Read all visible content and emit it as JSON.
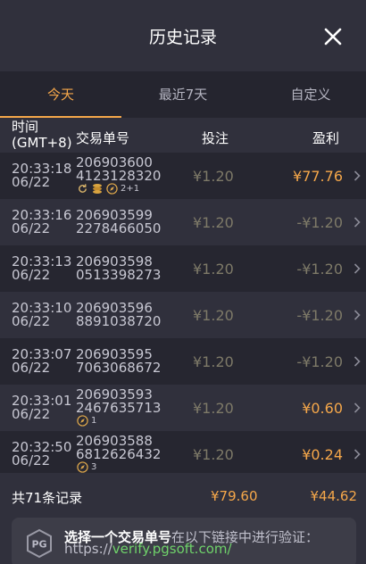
{
  "header": {
    "title": "历史记录"
  },
  "tabs": [
    {
      "label": "今天",
      "active": true
    },
    {
      "label": "最近7天",
      "active": false
    },
    {
      "label": "自定义",
      "active": false
    }
  ],
  "columns": {
    "time": [
      "时间",
      "(GMT+8)"
    ],
    "order": "交易单号",
    "bet": "投注",
    "profit": "盈利"
  },
  "rows": [
    {
      "time": [
        "20:33:18",
        "06/22"
      ],
      "order": [
        "206903600",
        "4123128320"
      ],
      "bet": "¥1.20",
      "profit": "¥77.76",
      "win": true,
      "badges": [
        {
          "icon": "respin-icon"
        },
        {
          "icon": "coin-stack-icon"
        },
        {
          "icon": "compass-icon",
          "count": "2+1"
        }
      ]
    },
    {
      "time": [
        "20:33:16",
        "06/22"
      ],
      "order": [
        "206903599",
        "2278466050"
      ],
      "bet": "¥1.20",
      "profit": "-¥1.20",
      "win": false,
      "badges": []
    },
    {
      "time": [
        "20:33:13",
        "06/22"
      ],
      "order": [
        "206903598",
        "0513398273"
      ],
      "bet": "¥1.20",
      "profit": "-¥1.20",
      "win": false,
      "badges": []
    },
    {
      "time": [
        "20:33:10",
        "06/22"
      ],
      "order": [
        "206903596",
        "8891038720"
      ],
      "bet": "¥1.20",
      "profit": "-¥1.20",
      "win": false,
      "badges": []
    },
    {
      "time": [
        "20:33:07",
        "06/22"
      ],
      "order": [
        "206903595",
        "7063068672"
      ],
      "bet": "¥1.20",
      "profit": "-¥1.20",
      "win": false,
      "badges": []
    },
    {
      "time": [
        "20:33:01",
        "06/22"
      ],
      "order": [
        "206903593",
        "2467635713"
      ],
      "bet": "¥1.20",
      "profit": "¥0.60",
      "win": true,
      "badges": [
        {
          "icon": "compass-icon",
          "count": "1"
        }
      ]
    },
    {
      "time": [
        "20:32:50",
        "06/22"
      ],
      "order": [
        "206903588",
        "6812626432"
      ],
      "bet": "¥1.20",
      "profit": "¥0.24",
      "win": true,
      "badges": [
        {
          "icon": "compass-icon",
          "count": "3"
        }
      ]
    }
  ],
  "summary": {
    "label": "共71条记录",
    "total_bet": "¥79.60",
    "total_profit": "¥44.62"
  },
  "verify": {
    "logo_text": "PG",
    "bold": "选择一个交易单号",
    "rest": "在以下链接中进行验证：",
    "url_prefix": "https://",
    "url": "verify.pgsoft.com/"
  },
  "colors": {
    "accent": "#f5a74a",
    "loss": "#7e7a68",
    "link": "#6fd26a"
  }
}
